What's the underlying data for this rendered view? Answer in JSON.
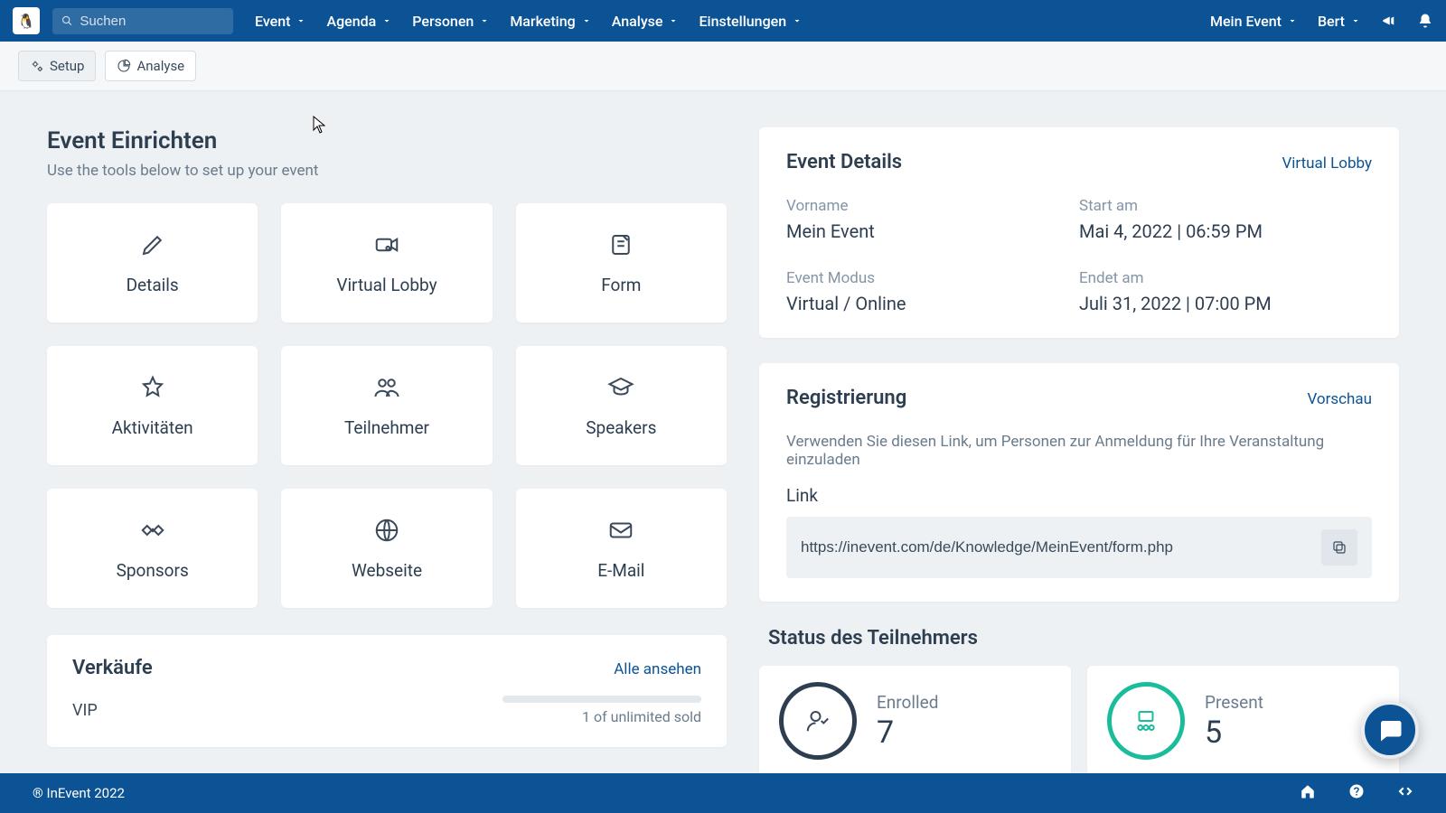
{
  "header": {
    "search_placeholder": "Suchen",
    "nav": [
      "Event",
      "Agenda",
      "Personen",
      "Marketing",
      "Analyse",
      "Einstellungen"
    ],
    "event_switch": "Mein Event",
    "user": "Bert"
  },
  "subnav": {
    "setup": "Setup",
    "analyse": "Analyse"
  },
  "setup": {
    "title": "Event Einrichten",
    "subtitle": "Use the tools below to set up your event",
    "tiles": [
      "Details",
      "Virtual Lobby",
      "Form",
      "Aktivitäten",
      "Teilnehmer",
      "Speakers",
      "Sponsors",
      "Webseite",
      "E-Mail"
    ]
  },
  "sales": {
    "title": "Verkäufe",
    "view_all": "Alle ansehen",
    "item_name": "VIP",
    "item_stat": "1 of unlimited sold"
  },
  "details": {
    "title": "Event Details",
    "link": "Virtual Lobby",
    "rows": {
      "name_label": "Vorname",
      "name_value": "Mein Event",
      "start_label": "Start am",
      "start_value": "Mai 4, 2022 | 06:59 PM",
      "mode_label": "Event Modus",
      "mode_value": "Virtual / Online",
      "end_label": "Endet am",
      "end_value": "Juli 31, 2022 | 07:00 PM"
    }
  },
  "registration": {
    "title": "Registrierung",
    "preview": "Vorschau",
    "desc": "Verwenden Sie diesen Link, um Personen zur Anmeldung für Ihre Veranstaltung einzuladen",
    "link_label": "Link",
    "link_value": "https://inevent.com/de/Knowledge/MeinEvent/form.php"
  },
  "status": {
    "title": "Status des Teilnehmers",
    "enrolled_label": "Enrolled",
    "enrolled_value": "7",
    "present_label": "Present",
    "present_value": "5"
  },
  "footer": {
    "copyright": "® InEvent 2022"
  }
}
